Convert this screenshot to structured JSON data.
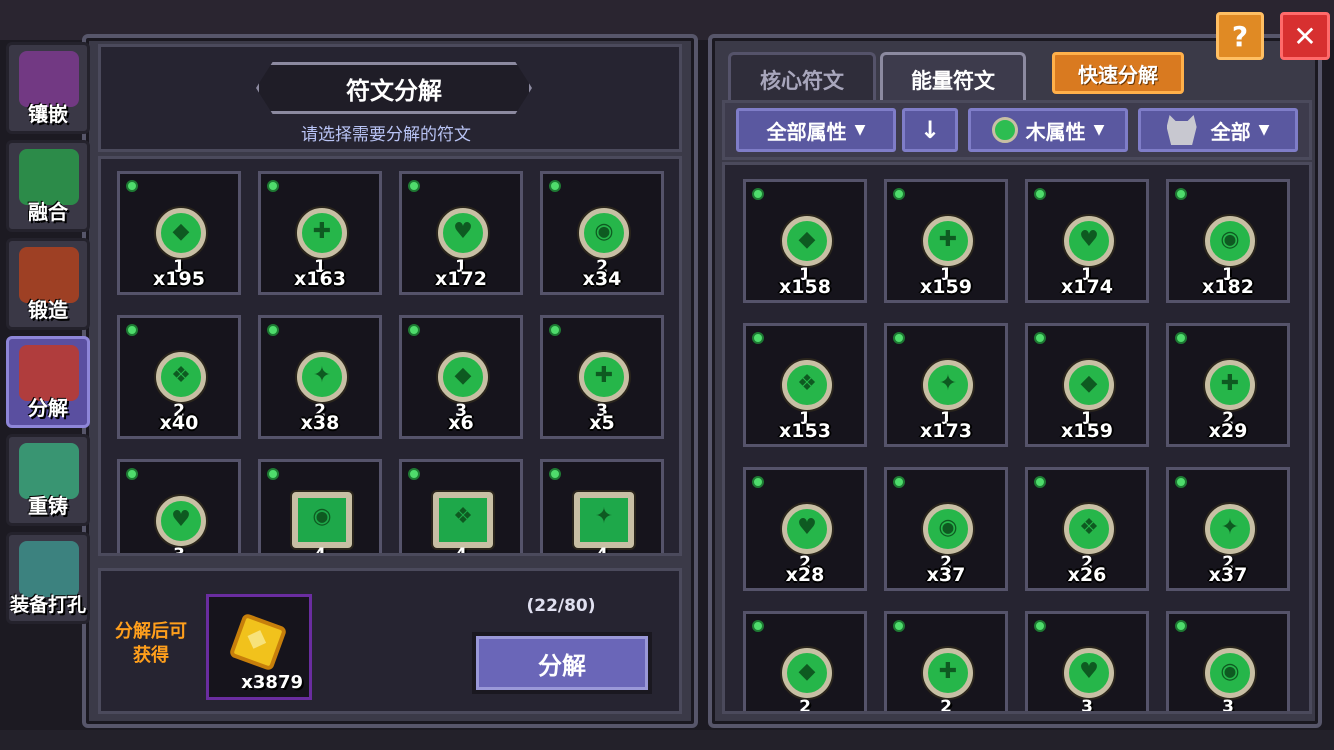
{
  "side_tabs": [
    {
      "label": "镶嵌",
      "icon": "socket-icon"
    },
    {
      "label": "融合",
      "icon": "fusion-icon"
    },
    {
      "label": "锻造",
      "icon": "forge-icon"
    },
    {
      "label": "分解",
      "icon": "decompose-icon",
      "active": true
    },
    {
      "label": "重铸",
      "icon": "recast-icon"
    },
    {
      "label": "装备打孔",
      "icon": "drill-icon"
    }
  ],
  "left": {
    "title": "符文分解",
    "subtitle": "请选择需要分解的符文",
    "runes": [
      {
        "level": "1",
        "count": "x195",
        "shape": "round"
      },
      {
        "level": "1",
        "count": "x163",
        "shape": "round"
      },
      {
        "level": "1",
        "count": "x172",
        "shape": "round"
      },
      {
        "level": "2",
        "count": "x34",
        "shape": "round"
      },
      {
        "level": "2",
        "count": "x40",
        "shape": "round"
      },
      {
        "level": "2",
        "count": "x38",
        "shape": "round"
      },
      {
        "level": "3",
        "count": "x6",
        "shape": "round"
      },
      {
        "level": "3",
        "count": "x5",
        "shape": "round"
      },
      {
        "level": "3",
        "count": "",
        "shape": "round"
      },
      {
        "level": "4",
        "count": "",
        "shape": "square"
      },
      {
        "level": "4",
        "count": "",
        "shape": "square"
      },
      {
        "level": "4",
        "count": "",
        "shape": "square"
      }
    ],
    "yield_label": "分解后可获得",
    "yield_count": "x3879",
    "progress": "(22/80)",
    "decompose_button": "分解"
  },
  "right": {
    "tabs": [
      {
        "label": "核心符文",
        "active": false
      },
      {
        "label": "能量符文",
        "active": true
      }
    ],
    "quick_button": "快速分解",
    "filters": {
      "attribute": "全部属性",
      "sort_arrow": "↓",
      "element": "木属性",
      "monster": "全部"
    },
    "runes": [
      {
        "level": "1",
        "count": "x158"
      },
      {
        "level": "1",
        "count": "x159"
      },
      {
        "level": "1",
        "count": "x174"
      },
      {
        "level": "1",
        "count": "x182"
      },
      {
        "level": "1",
        "count": "x153"
      },
      {
        "level": "1",
        "count": "x173"
      },
      {
        "level": "1",
        "count": "x159"
      },
      {
        "level": "2",
        "count": "x29"
      },
      {
        "level": "2",
        "count": "x28"
      },
      {
        "level": "2",
        "count": "x37"
      },
      {
        "level": "2",
        "count": "x26"
      },
      {
        "level": "2",
        "count": "x37"
      },
      {
        "level": "2",
        "count": ""
      },
      {
        "level": "2",
        "count": ""
      },
      {
        "level": "3",
        "count": ""
      },
      {
        "level": "3",
        "count": ""
      }
    ]
  },
  "top_buttons": {
    "help": "?",
    "close": "✕"
  },
  "colors": {
    "accent_orange": "#d97a20",
    "rune_green": "#26b64a",
    "close_red": "#d73030",
    "button_purple": "#6a66b8"
  }
}
